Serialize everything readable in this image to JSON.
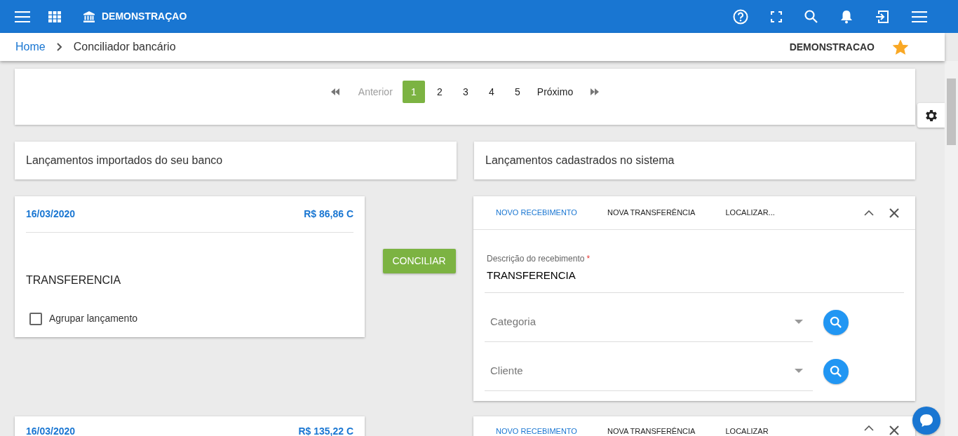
{
  "topbar": {
    "company": "DEMONSTRAÇAO"
  },
  "breadcrumb": [
    {
      "label": "Home",
      "kind": "link"
    },
    {
      "label": "Conciliador bancário",
      "kind": "current"
    }
  ],
  "account": {
    "name": "DEMONSTRACAO",
    "favorite": true
  },
  "pagination": {
    "previous": {
      "label": "Anterior",
      "disabled": true
    },
    "pages": [
      {
        "label": "1",
        "selected": true
      },
      {
        "label": "2",
        "selected": false
      },
      {
        "label": "3",
        "selected": false
      },
      {
        "label": "4",
        "selected": false
      },
      {
        "label": "5",
        "selected": false
      }
    ],
    "next": {
      "label": "Próximo",
      "disabled": false
    }
  },
  "sections": [
    "Lançamentos importados do seu banco",
    "Lançamentos cadastrados no sistema"
  ],
  "entries": [
    {
      "date": "16/03/2020",
      "amount": "R$ 86,86 C",
      "description": "TRANSFERENCIA",
      "group": {
        "label": "Agrupar lançamento",
        "checked": false
      },
      "action": "CONCILIAR",
      "tabs": [
        {
          "label": "NOVO RECEBIMENTO",
          "selected": true
        },
        {
          "label": "NOVA TRANSFERÊNCIA",
          "selected": false
        },
        {
          "label": "LOCALIZAR...",
          "selected": false
        }
      ],
      "description_field": {
        "label": "Descrição do recebimento",
        "required_mark": "*",
        "value": "TRANSFERENCIA"
      },
      "selects": [
        {
          "placeholder": "Categoria"
        },
        {
          "placeholder": "Cliente"
        }
      ]
    },
    {
      "date": "16/03/2020",
      "amount": "R$ 135,22 C",
      "tabs": [
        {
          "label": "NOVO RECEBIMENTO",
          "selected": true
        },
        {
          "label": "NOVA TRANSFERÊNCIA",
          "selected": false
        },
        {
          "label": "LOCALIZAR",
          "selected": false
        }
      ]
    }
  ]
}
